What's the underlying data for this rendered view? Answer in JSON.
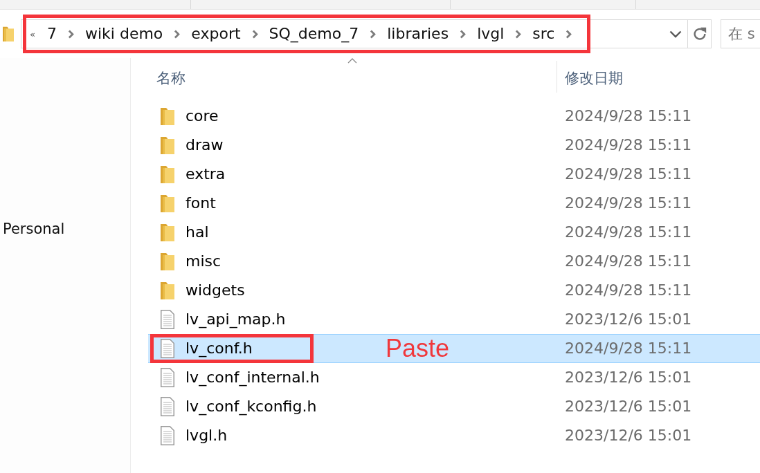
{
  "address_bar": {
    "overflow": "«",
    "highlighted": true,
    "path": [
      {
        "label": "7"
      },
      {
        "label": "wiki demo"
      },
      {
        "label": "export"
      },
      {
        "label": "SQ_demo_7"
      },
      {
        "label": "libraries"
      },
      {
        "label": "lvgl"
      },
      {
        "label": "src"
      }
    ]
  },
  "search": {
    "placeholder": "在 s"
  },
  "nav_pane": {
    "items": [
      {
        "label": "Personal"
      }
    ]
  },
  "file_list": {
    "columns": [
      {
        "label": "名称",
        "sorted": true
      },
      {
        "label": "修改日期",
        "sorted": false
      }
    ],
    "rows": [
      {
        "name": "core",
        "kind": "folder",
        "modified": "2024/9/28 15:11",
        "selected": false,
        "highlighted": false
      },
      {
        "name": "draw",
        "kind": "folder",
        "modified": "2024/9/28 15:11",
        "selected": false,
        "highlighted": false
      },
      {
        "name": "extra",
        "kind": "folder",
        "modified": "2024/9/28 15:11",
        "selected": false,
        "highlighted": false
      },
      {
        "name": "font",
        "kind": "folder",
        "modified": "2024/9/28 15:11",
        "selected": false,
        "highlighted": false
      },
      {
        "name": "hal",
        "kind": "folder",
        "modified": "2024/9/28 15:11",
        "selected": false,
        "highlighted": false
      },
      {
        "name": "misc",
        "kind": "folder",
        "modified": "2024/9/28 15:11",
        "selected": false,
        "highlighted": false
      },
      {
        "name": "widgets",
        "kind": "folder",
        "modified": "2024/9/28 15:11",
        "selected": false,
        "highlighted": false
      },
      {
        "name": "lv_api_map.h",
        "kind": "file",
        "modified": "2023/12/6 15:01",
        "selected": false,
        "highlighted": false
      },
      {
        "name": "lv_conf.h",
        "kind": "file",
        "modified": "2024/9/28 15:11",
        "selected": true,
        "highlighted": true,
        "note": "Paste"
      },
      {
        "name": "lv_conf_internal.h",
        "kind": "file",
        "modified": "2023/12/6 15:01",
        "selected": false,
        "highlighted": false
      },
      {
        "name": "lv_conf_kconfig.h",
        "kind": "file",
        "modified": "2023/12/6 15:01",
        "selected": false,
        "highlighted": false
      },
      {
        "name": "lvgl.h",
        "kind": "file",
        "modified": "2023/12/6 15:01",
        "selected": false,
        "highlighted": false
      }
    ]
  }
}
